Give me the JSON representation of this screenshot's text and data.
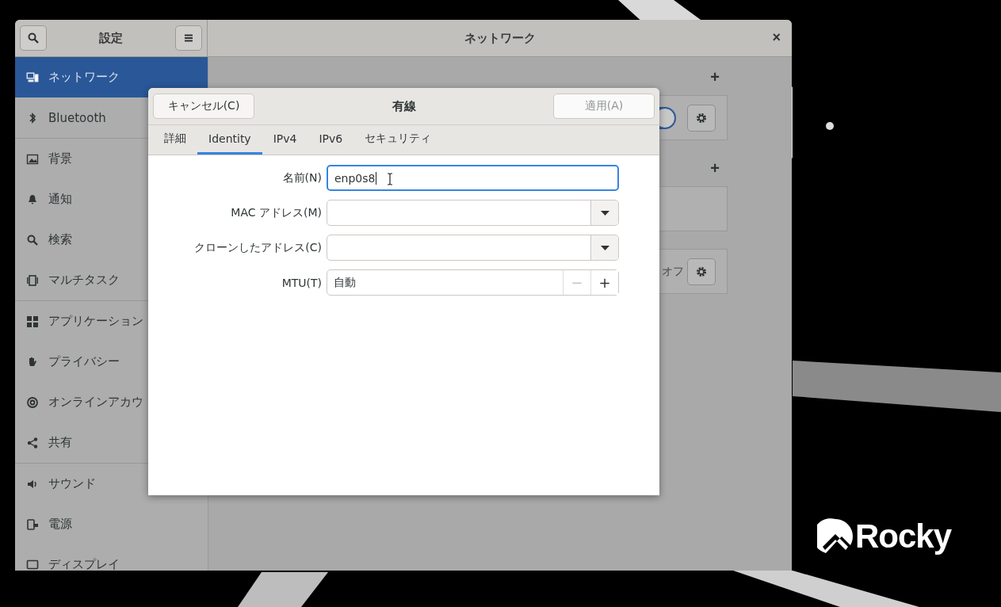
{
  "desktop": {
    "logo_text": "Rocky"
  },
  "window": {
    "sidebar_title": "設定",
    "title": "ネットワーク",
    "close": "×"
  },
  "sidebar": {
    "groups": [
      {
        "items": [
          {
            "label": "ネットワーク",
            "selected": true
          },
          {
            "label": "Bluetooth",
            "selected": false
          }
        ]
      },
      {
        "items": [
          {
            "label": "背景",
            "selected": false
          },
          {
            "label": "通知",
            "selected": false
          },
          {
            "label": "検索",
            "selected": false
          },
          {
            "label": "マルチタスク",
            "selected": false
          }
        ]
      },
      {
        "items": [
          {
            "label": "アプリケーション",
            "selected": false
          },
          {
            "label": "プライバシー",
            "selected": false
          },
          {
            "label": "オンラインアカウ",
            "selected": false
          },
          {
            "label": "共有",
            "selected": false
          }
        ]
      },
      {
        "items": [
          {
            "label": "サウンド",
            "selected": false
          },
          {
            "label": "電源",
            "selected": false
          },
          {
            "label": "ディスプレイ",
            "selected": false
          }
        ]
      }
    ]
  },
  "main": {
    "sections": [
      {
        "add_button": "+",
        "row": {
          "kind": "switch",
          "on": true
        }
      },
      {
        "add_button": "+",
        "row": {
          "kind": "empty"
        }
      },
      {
        "row": {
          "kind": "status",
          "status": "オフ"
        }
      }
    ]
  },
  "dialog": {
    "title": "有線",
    "cancel": "キャンセル(C)",
    "apply": {
      "label": "適用(A)",
      "disabled": true
    },
    "tabs": [
      {
        "label": "詳細",
        "selected": false
      },
      {
        "label": "Identity",
        "selected": true
      },
      {
        "label": "IPv4",
        "selected": false
      },
      {
        "label": "IPv6",
        "selected": false
      },
      {
        "label": "セキュリティ",
        "selected": false
      }
    ],
    "fields": [
      {
        "kind": "entry",
        "label": "名前(N)",
        "value": "enp0s8",
        "focused": true
      },
      {
        "kind": "combo",
        "label": "MAC アドレス(M)"
      },
      {
        "kind": "combo",
        "label": "クローンしたアドレス(C)"
      },
      {
        "kind": "spin",
        "label": "MTU(T)",
        "value": "自動",
        "decrement": "−",
        "increment": "+",
        "decrement_disabled": true
      }
    ]
  }
}
